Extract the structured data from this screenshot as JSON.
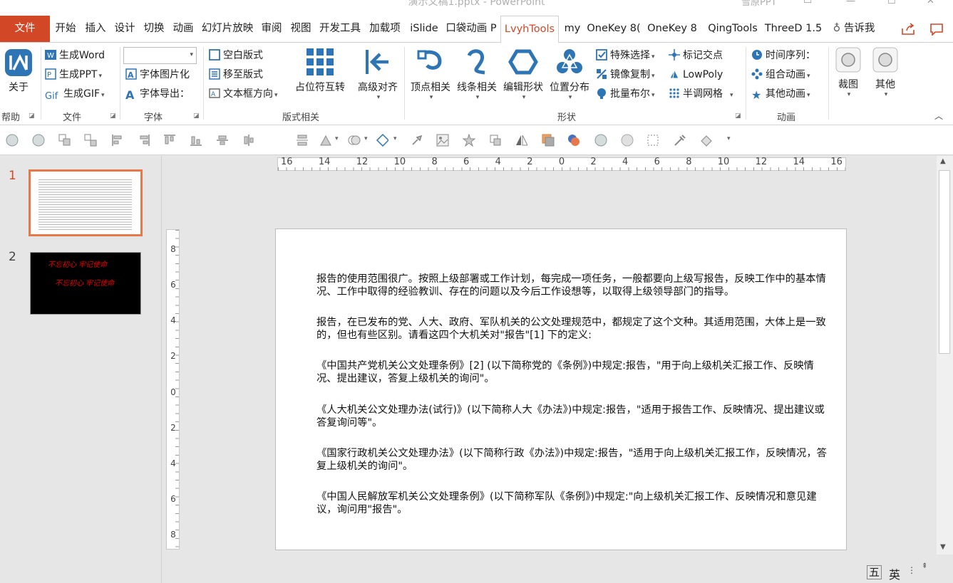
{
  "titlebar": {
    "doc_title": "演示文稿1.pptx - PowerPoint",
    "user": "雪原PPT"
  },
  "tabs": [
    "文件",
    "开始",
    "插入",
    "设计",
    "切换",
    "动画",
    "幻灯片放映",
    "审阅",
    "视图",
    "开发工具",
    "加载项",
    "iSlide",
    "口袋动画 P",
    "LvyhTools",
    "my",
    "OneKey 8(",
    "OneKey 8",
    "QingTools",
    "ThreeD 1.5"
  ],
  "tellme": "告诉我",
  "ribbon": {
    "help": {
      "about": "关于",
      "label": "帮助"
    },
    "file": {
      "gen_word": "生成Word",
      "gen_ppt": "生成PPT",
      "gen_gif": "生成GIF",
      "label": "文件"
    },
    "font": {
      "font_image": "字体图片化",
      "font_export": "字体导出：",
      "label": "字体"
    },
    "layout": {
      "blank": "空白版式",
      "move": "移至版式",
      "textdir": "文本框方向",
      "swap": "占位符互转",
      "align": "高级对齐",
      "label": "版式相关"
    },
    "shape": {
      "vertex": "顶点相关",
      "line": "线条相关",
      "edit": "编辑形状",
      "distribute": "位置分布",
      "select": "特殊选择",
      "mirror": "镜像复制",
      "boolean": "批量布尔",
      "mark": "标记交点",
      "lowpoly": "LowPoly",
      "halftone": "半调网格",
      "label": "形状"
    },
    "anim": {
      "timeline": "时间序列：",
      "combine": "组合动画",
      "other": "其他动画",
      "label": "动画"
    },
    "crop": "裁图",
    "misc": "其他"
  },
  "thumbnails": [
    {
      "num": "1"
    },
    {
      "num": "2",
      "line1": "不忘初心 牢记使命",
      "line2": "不忘初心 牢记使命"
    }
  ],
  "ruler": {
    "h_ticks": [
      "16",
      "14",
      "12",
      "10",
      "8",
      "6",
      "4",
      "2",
      "0",
      "2",
      "4",
      "6",
      "8",
      "10",
      "12",
      "14",
      "16"
    ],
    "v_ticks": [
      "8",
      "6",
      "4",
      "2",
      "0",
      "2",
      "4",
      "6",
      "8"
    ]
  },
  "slide": {
    "paragraphs": [
      "报告的使用范围很广。按照上级部署或工作计划，每完成一项任务，一般都要向上级写报告，反映工作中的基本情况、工作中取得的经验教训、存在的问题以及今后工作设想等，以取得上级领导部门的指导。",
      "报告，在已发布的党、人大、政府、军队机关的公文处理规范中，都规定了这个文种。其适用范围，大体上是一致的，但也有些区别。请看这四个大机关对\"报告\"[1] 下的定义:",
      "《中国共产党机关公文处理条例》[2] (以下简称党的《条例》)中规定:报告，\"用于向上级机关汇报工作、反映情况、提出建议，答复上级机关的询问\"。",
      "《人大机关公文处理办法(试行)》(以下简称人大《办法》)中规定:报告，\"适用于报告工作、反映情况、提出建议或答复询问等\"。",
      "《国家行政机关公文处理办法》(以下简称行政《办法》)中规定:报告，\"适用于向上级机关汇报工作，反映情况，答复上级机关的询问\"。",
      "《中国人民解放军机关公文处理条例》(以下简称军队《条例》)中规定:\"向上级机关汇报工作、反映情况和意见建议，询问用\"报告\"。"
    ]
  },
  "statusbar": {
    "ime1": "五",
    "ime2": "英"
  },
  "colors": {
    "accent": "#d24726",
    "icon_blue": "#2e75b6",
    "selection": "#e8784a"
  }
}
